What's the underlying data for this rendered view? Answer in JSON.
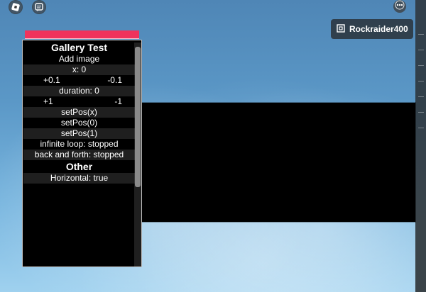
{
  "top_left": {
    "roblox_button_icon": "roblox-logo-icon",
    "chat_button_icon": "chat-icon"
  },
  "top_right": {
    "more_button_icon": "ellipsis-icon",
    "username_pill": {
      "icon": "roblox-r-icon",
      "label": "Rockraider400"
    }
  },
  "gallery_panel": {
    "title": "Gallery Test",
    "rows": [
      {
        "text": "Add image"
      },
      {
        "text": "x: 0"
      },
      {
        "pair": [
          "+0.1",
          "-0.1"
        ]
      },
      {
        "text": "duration: 0"
      },
      {
        "pair": [
          "+1",
          "-1"
        ]
      },
      {
        "text": "setPos(x)"
      },
      {
        "text": "setPos(0)"
      },
      {
        "text": "setPos(1)"
      },
      {
        "text": "infinite loop: stopped"
      },
      {
        "text": "back and forth: stopped"
      }
    ],
    "section_other": "Other",
    "other_rows": [
      {
        "text": "Horizontal: true"
      }
    ]
  },
  "colors": {
    "header_accent": "#f0335c",
    "panel_bg": "#000000",
    "viewer_bg": "#000000"
  }
}
